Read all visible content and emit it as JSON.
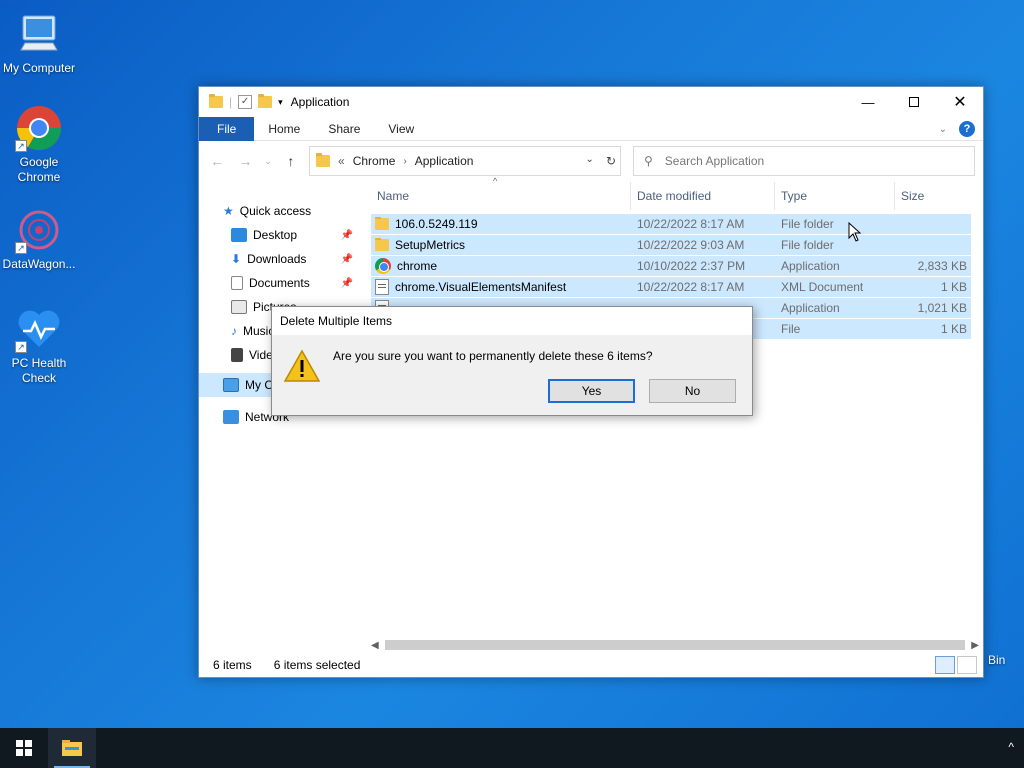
{
  "desktop": {
    "icons": [
      {
        "label": "My Computer"
      },
      {
        "label": "Google Chrome"
      },
      {
        "label": "DataWagon..."
      },
      {
        "label": "PC Health Check"
      }
    ],
    "recycle_partial": "Bin"
  },
  "window": {
    "title": "Application",
    "ribbon": {
      "file": "File",
      "home": "Home",
      "share": "Share",
      "view": "View"
    },
    "address": {
      "root": "Chrome",
      "current": "Application",
      "overflow": "«"
    },
    "search": {
      "placeholder": "Search Application"
    },
    "nav": {
      "quick_access": "Quick access",
      "items": [
        "Desktop",
        "Downloads",
        "Documents",
        "Pictures",
        "Music",
        "Videos"
      ],
      "this_pc": "My Computer",
      "network": "Network"
    },
    "columns": {
      "name": "Name",
      "date": "Date modified",
      "type": "Type",
      "size": "Size"
    },
    "files": [
      {
        "name": "106.0.5249.119",
        "date": "10/22/2022 8:17 AM",
        "type": "File folder",
        "size": "",
        "icon": "folder-icon"
      },
      {
        "name": "SetupMetrics",
        "date": "10/22/2022 9:03 AM",
        "type": "File folder",
        "size": "",
        "icon": "folder-icon"
      },
      {
        "name": "chrome",
        "date": "10/10/2022 2:37 PM",
        "type": "Application",
        "size": "2,833 KB",
        "icon": "chrome-icon"
      },
      {
        "name": "chrome.VisualElementsManifest",
        "date": "10/22/2022 8:17 AM",
        "type": "XML Document",
        "size": "1 KB",
        "icon": "xml-icon"
      },
      {
        "name": "",
        "date": "",
        "type": "Application",
        "size": "1,021 KB",
        "icon": "app-icon"
      },
      {
        "name": "",
        "date": "",
        "type": "File",
        "size": "1 KB",
        "icon": "file-icon"
      }
    ],
    "status": {
      "count": "6 items",
      "selected": "6 items selected"
    }
  },
  "dialog": {
    "title": "Delete Multiple Items",
    "message": "Are you sure you want to permanently delete these 6 items?",
    "yes": "Yes",
    "no": "No"
  },
  "colors": {
    "accent": "#1a5fb4",
    "selection": "#cce8ff",
    "desktop": "#1677d6"
  }
}
